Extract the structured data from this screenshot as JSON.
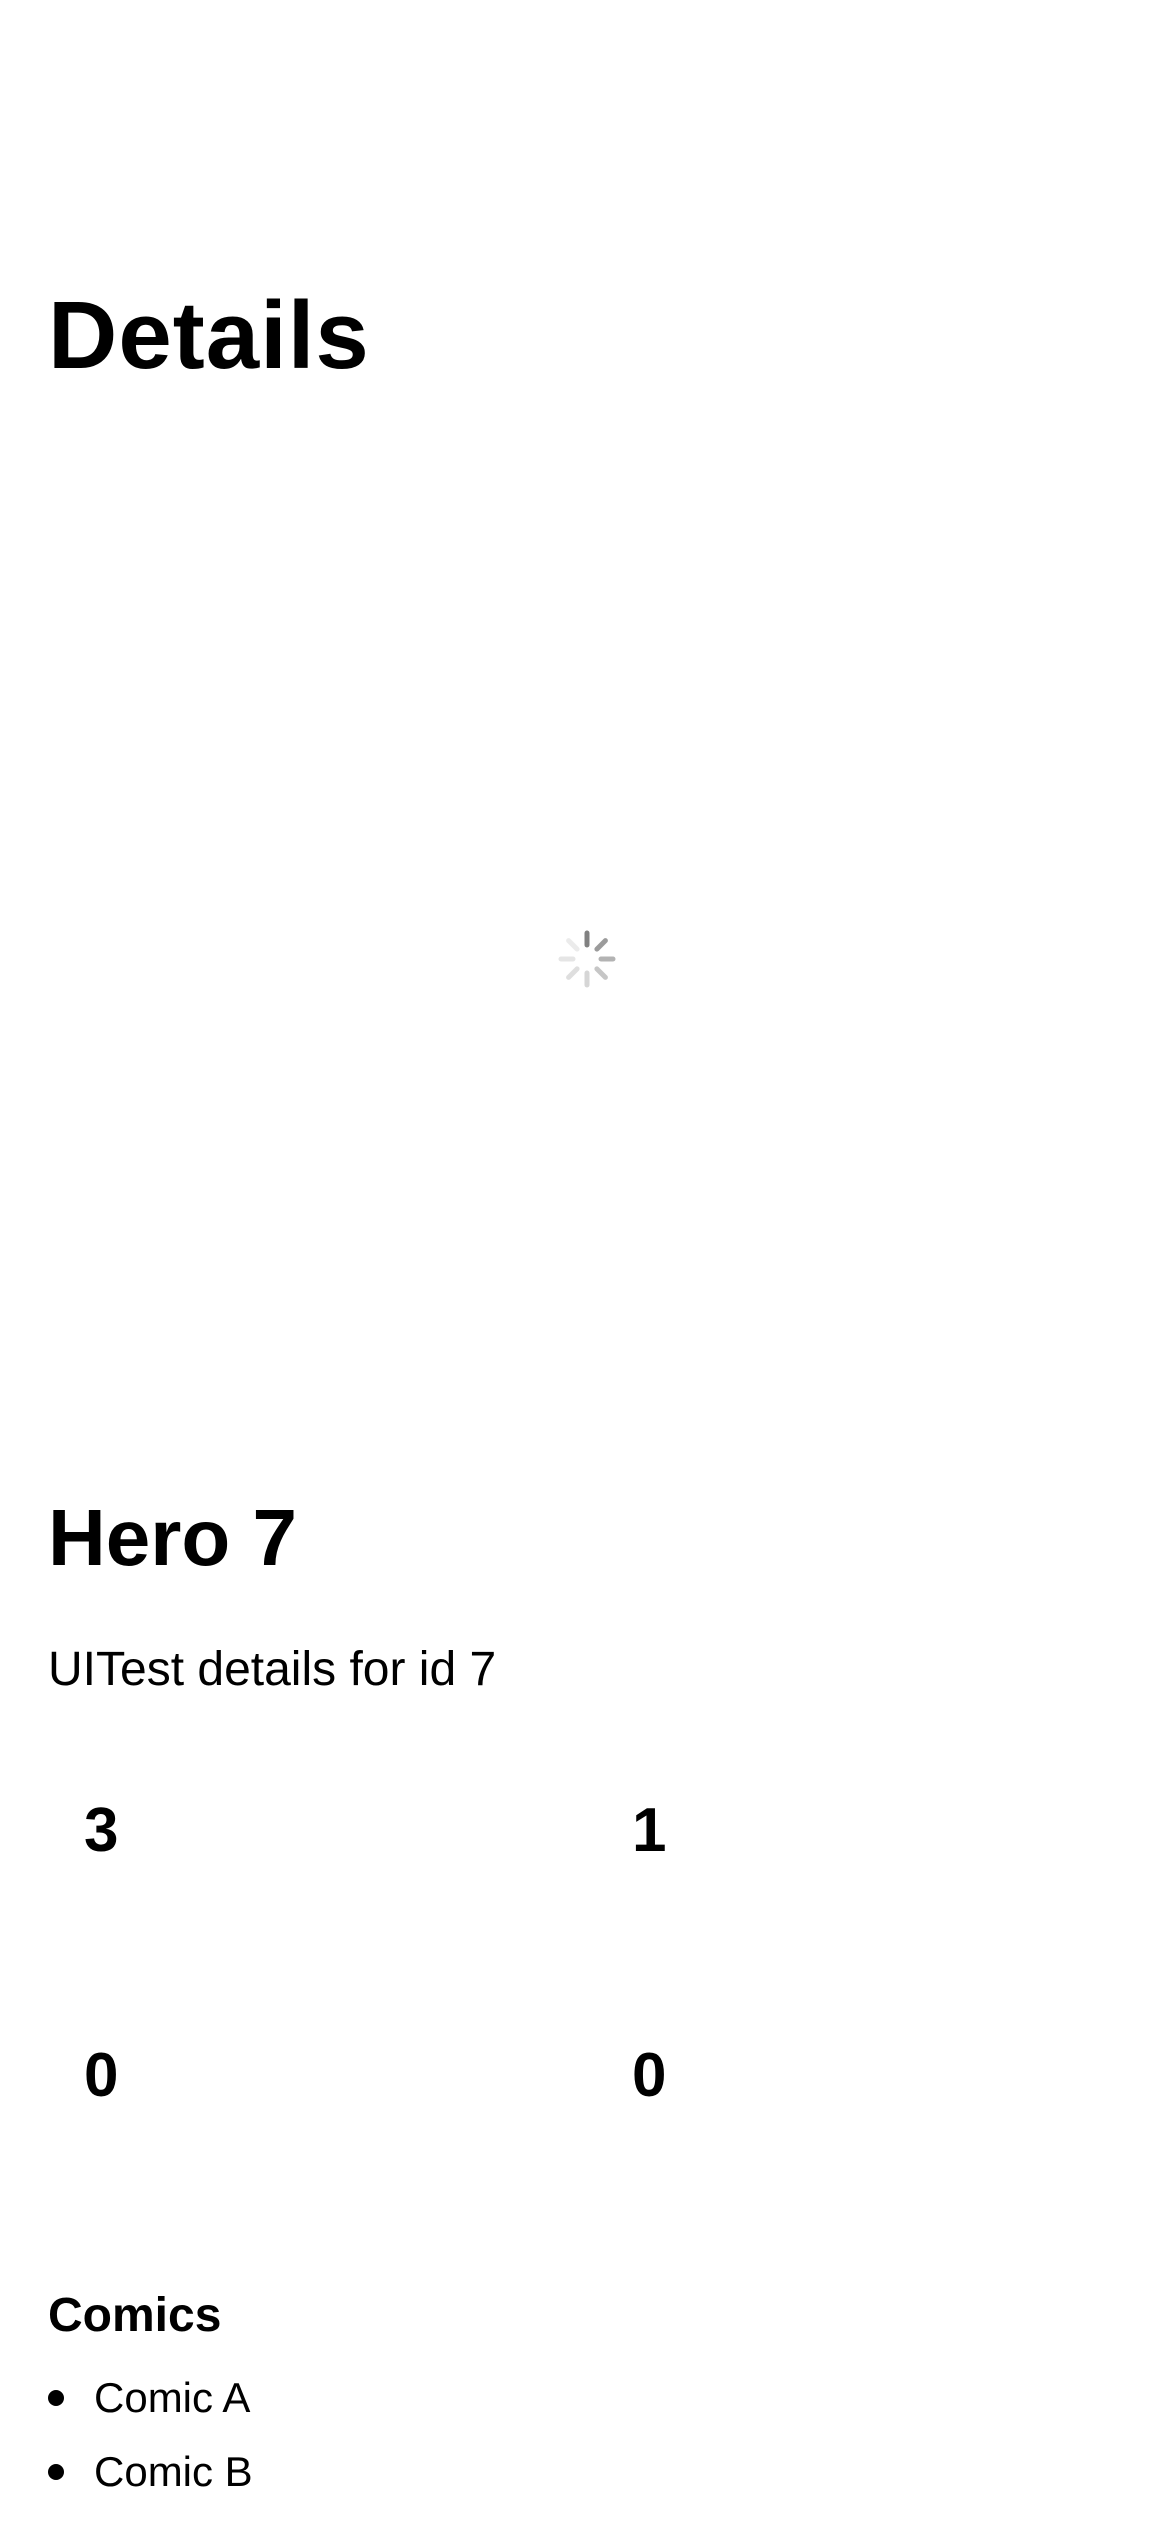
{
  "nav": {
    "title": "Details"
  },
  "hero_image": {
    "state": "loading",
    "loader_icon": "activity-spinner-icon"
  },
  "hero": {
    "name": "Hero 7",
    "description": "UITest details for id 7"
  },
  "stats": [
    "3",
    "1",
    "0",
    "0"
  ],
  "comics": {
    "heading": "Comics",
    "items": [
      "Comic A",
      "Comic B"
    ]
  },
  "colors": {
    "text": "#000000",
    "background": "#ffffff",
    "spinner": "#9a9a9a"
  }
}
